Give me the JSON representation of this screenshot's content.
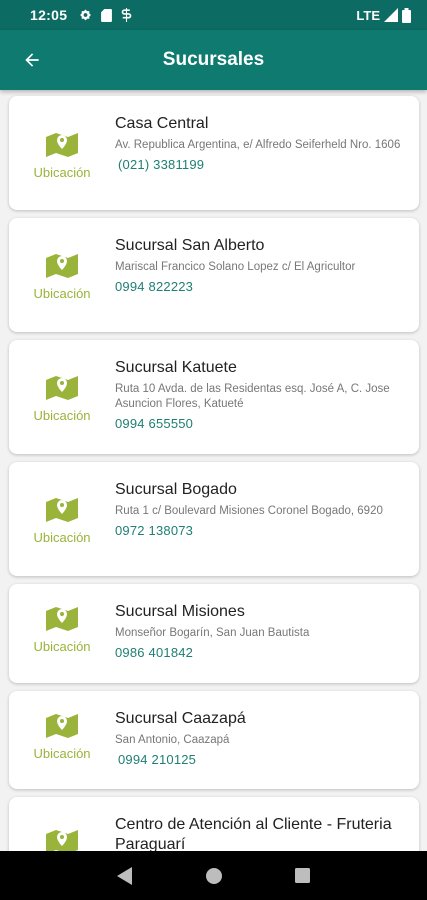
{
  "status_bar": {
    "time": "12:05",
    "network": "LTE",
    "icons": [
      "settings-icon",
      "sd-card-icon",
      "s-app-icon",
      "signal-icon",
      "battery-icon"
    ]
  },
  "header": {
    "title": "Sucursales",
    "back_icon": "arrow-left-icon"
  },
  "colors": {
    "primary": "#0f7a70",
    "status_bar": "#0c6b63",
    "location_accent": "#9ab33a",
    "phone_text": "#1e7f73"
  },
  "location_label": "Ubicación",
  "branches": [
    {
      "name": "Casa Central",
      "address": "Av. Republica Argentina, e/ Alfredo Seiferheld Nro. 1606",
      "phone": "(021) 3381199"
    },
    {
      "name": "Sucursal San Alberto",
      "address": "Mariscal Francico Solano Lopez c/ El Agricultor",
      "phone": "0994 822223"
    },
    {
      "name": "Sucursal Katuete",
      "address": "Ruta 10 Avda. de las Residentas esq. José A, C. Jose Asuncion Flores, Katueté",
      "phone": "0994 655550"
    },
    {
      "name": "Sucursal Bogado",
      "address": "Ruta 1 c/ Boulevard Misiones Coronel Bogado, 6920",
      "phone": "0972 138073"
    },
    {
      "name": "Sucursal Misiones",
      "address": "Monseñor Bogarín, San Juan Bautista",
      "phone": "0986 401842"
    },
    {
      "name": "Sucursal Caazapá",
      "address": "San Antonio, Caazapá",
      "phone": "0994 210125"
    },
    {
      "name": "Centro de Atención al Cliente - Fruteria Paraguarí",
      "address": "",
      "phone": ""
    }
  ],
  "nav_bar": {
    "icons": [
      "back-triangle-icon",
      "home-circle-icon",
      "recents-square-icon"
    ]
  }
}
